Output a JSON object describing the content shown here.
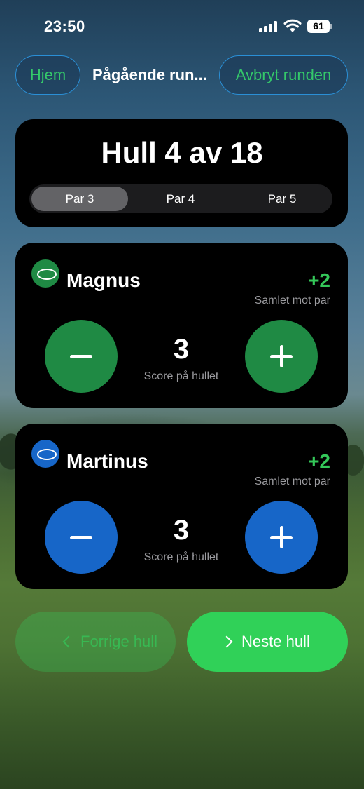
{
  "status_bar": {
    "time": "23:50",
    "battery": "61"
  },
  "nav": {
    "home_label": "Hjem",
    "title": "Pågående run...",
    "cancel_label": "Avbryt runden"
  },
  "hole": {
    "title": "Hull 4 av 18",
    "par_options": [
      "Par 3",
      "Par 4",
      "Par 5"
    ],
    "selected_par": "Par 3"
  },
  "players": [
    {
      "name": "Magnus",
      "total": "+2",
      "total_label": "Samlet mot par",
      "score": "3",
      "score_label": "Score på hullet",
      "color": "#1f8a44"
    },
    {
      "name": "Martinus",
      "total": "+2",
      "total_label": "Samlet mot par",
      "score": "3",
      "score_label": "Score på hullet",
      "color": "#1766c8"
    }
  ],
  "footer": {
    "prev_label": "Forrige hull",
    "next_label": "Neste hull"
  },
  "colors": {
    "accent_green": "#34c759",
    "nav_border": "#2a8fd6",
    "card_bg": "#000000"
  },
  "icons": {
    "signal": "cellular-signal-icon",
    "wifi": "wifi-icon",
    "battery": "battery-icon",
    "disc": "frisbee-disc-icon",
    "minus": "minus-icon",
    "plus": "plus-icon",
    "prev": "chevron-left-icon",
    "next": "chevron-right-icon"
  }
}
